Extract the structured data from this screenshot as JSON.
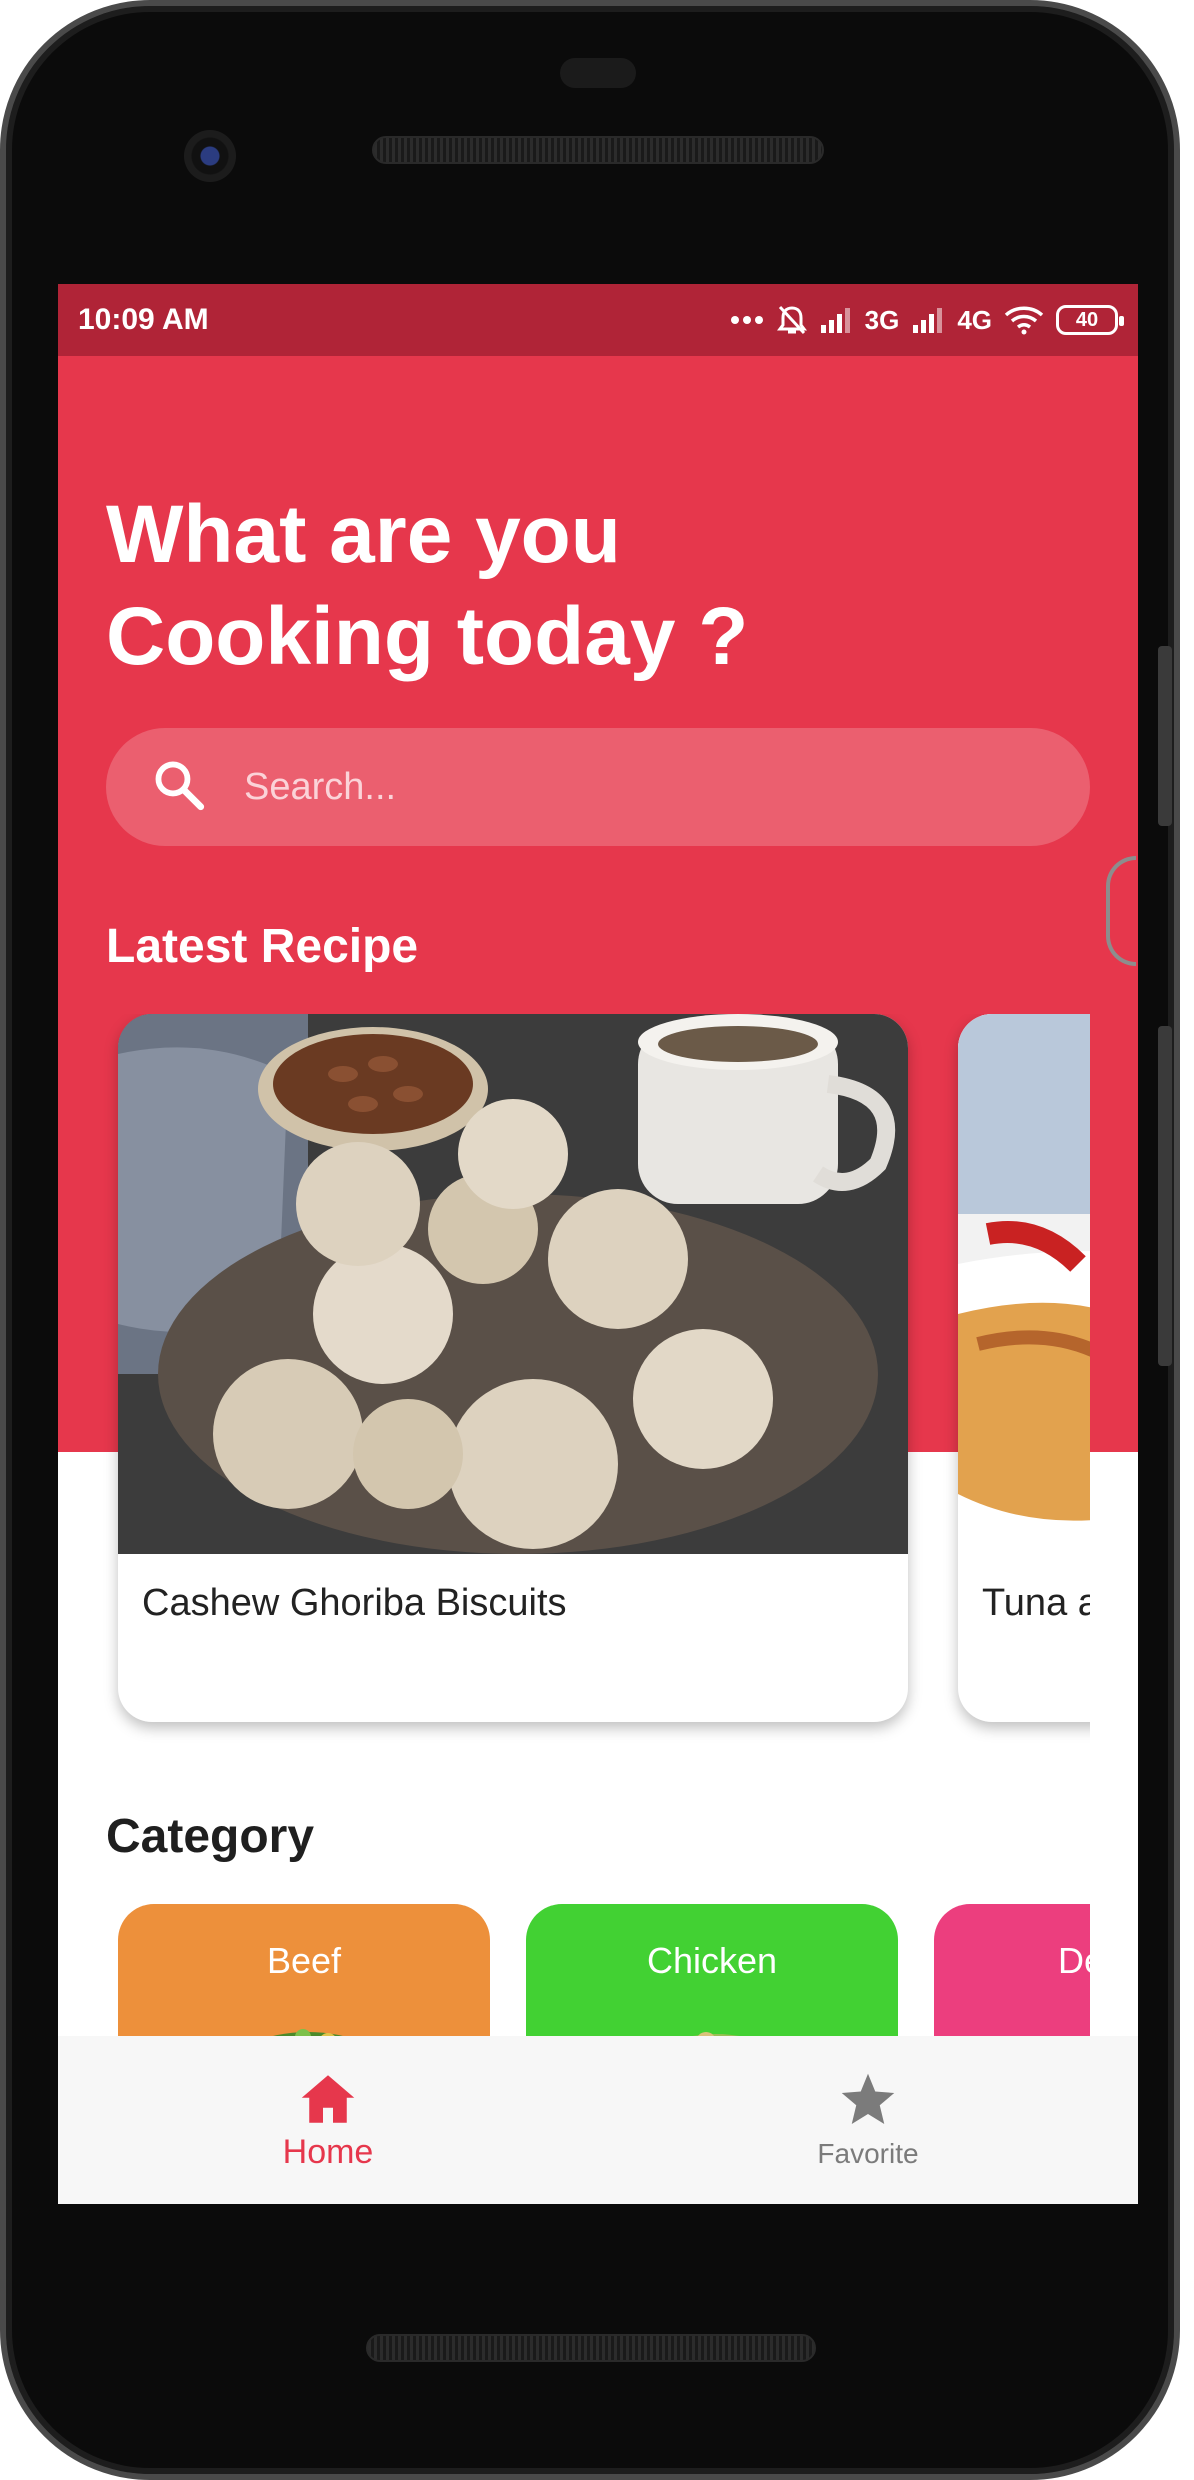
{
  "status_bar": {
    "time": "10:09 AM",
    "network_1": "3G",
    "network_2": "4G",
    "battery": "40"
  },
  "header": {
    "title_line_1": "What are you",
    "title_line_2": "Cooking today ?"
  },
  "search": {
    "placeholder": "Search..."
  },
  "latest": {
    "title": "Latest Recipe",
    "recipes": [
      {
        "name": "Cashew Ghoriba Biscuits"
      },
      {
        "name": "Tuna a"
      }
    ]
  },
  "category": {
    "title": "Category",
    "items": [
      {
        "label": "Beef",
        "color": "#ed903b"
      },
      {
        "label": "Chicken",
        "color": "#42d133"
      },
      {
        "label": "De",
        "color": "#ec3e7e"
      }
    ]
  },
  "bottom_nav": {
    "home_label": "Home",
    "favorite_label": "Favorite",
    "home_icon": "home-icon",
    "favorite_icon": "star-icon"
  },
  "colors": {
    "primary": "#e6374c",
    "status_bar": "#b02437",
    "nav_inactive": "#7b7b7b"
  }
}
